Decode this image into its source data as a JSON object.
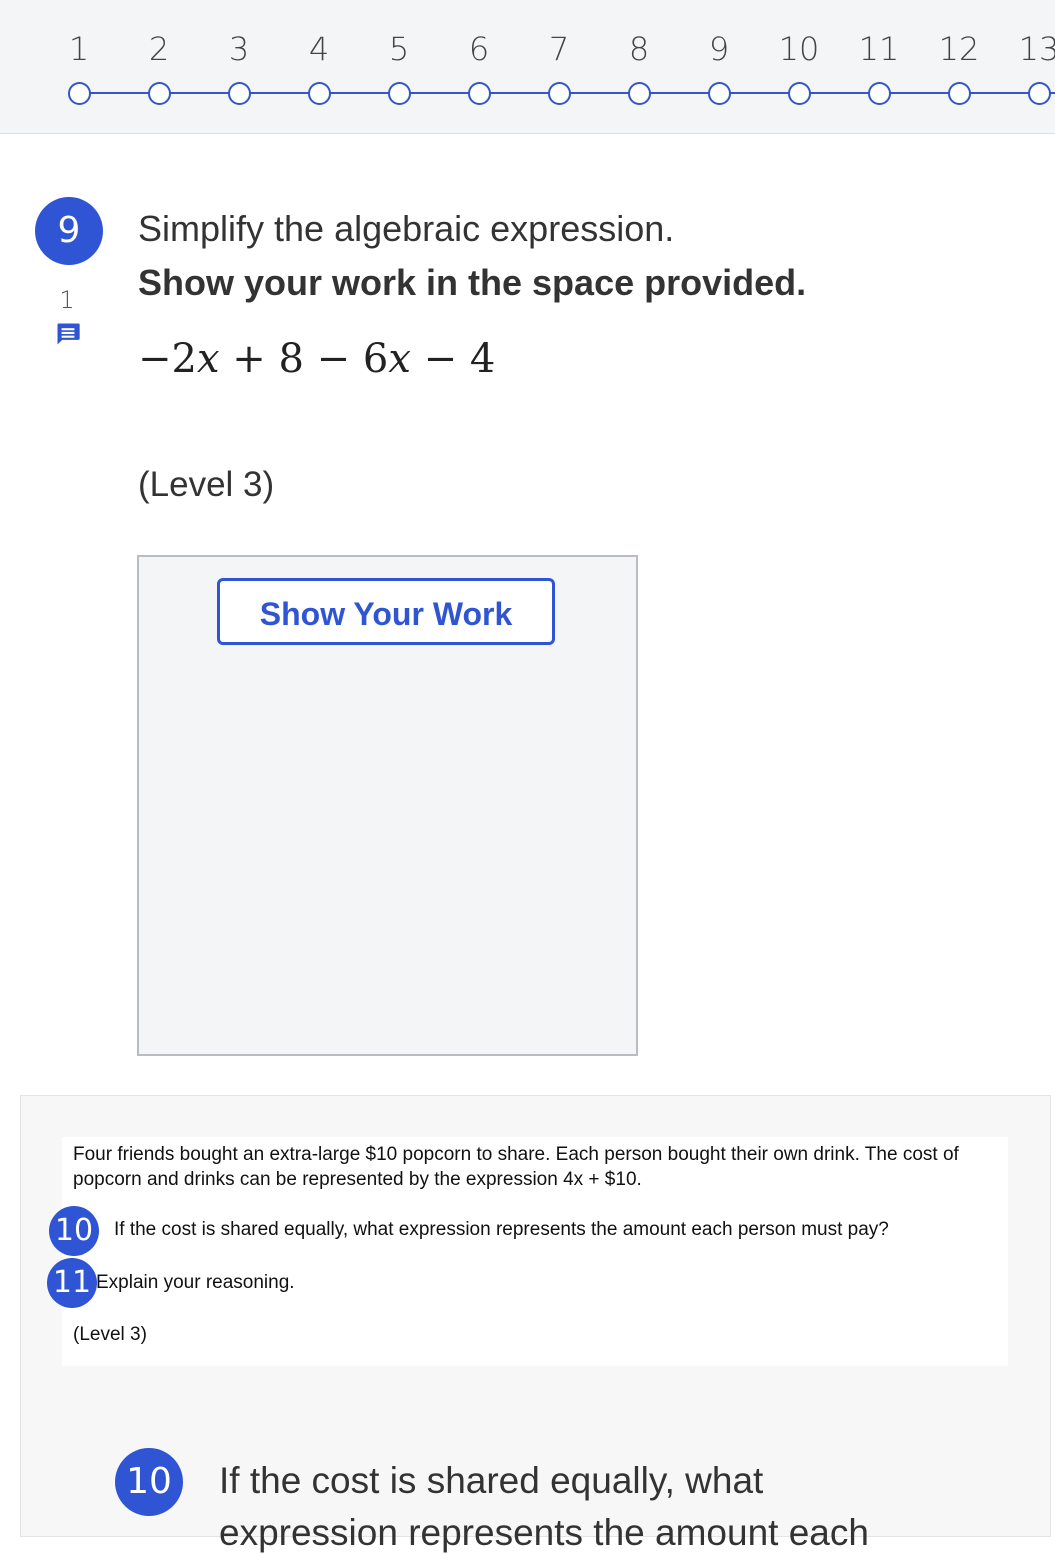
{
  "navigator": {
    "steps": [
      "1",
      "2",
      "3",
      "4",
      "5",
      "6",
      "7",
      "8",
      "9",
      "10",
      "11",
      "12",
      "13"
    ]
  },
  "question9": {
    "number": "9",
    "comment_count": "1",
    "prompt": "Simplify the algebraic expression.",
    "instruction": "Show your work in the space provided.",
    "expression": {
      "t1": "−2",
      "v1": "x",
      "t2": " + 8 − 6",
      "v2": "x",
      "t3": " − 4"
    },
    "level": "(Level 3)",
    "show_work_label": "Show Your Work"
  },
  "stimulus": {
    "paragraph": "Four friends bought an extra-large $10 popcorn to share. Each person bought their own drink. The cost of popcorn and drinks can be represented by the expression 4x + $10.",
    "badge10": "10",
    "line10": "If the cost is shared equally, what expression represents the amount each person must pay?",
    "badge11": "11",
    "line11": "Explain your reasoning.",
    "level": "(Level 3)"
  },
  "question10": {
    "number": "10",
    "text": "If the cost is shared equally, what",
    "text_continued": "expression represents the amount each"
  },
  "colors": {
    "accent": "#2f55d4",
    "nav_background": "#f4f5f7"
  }
}
